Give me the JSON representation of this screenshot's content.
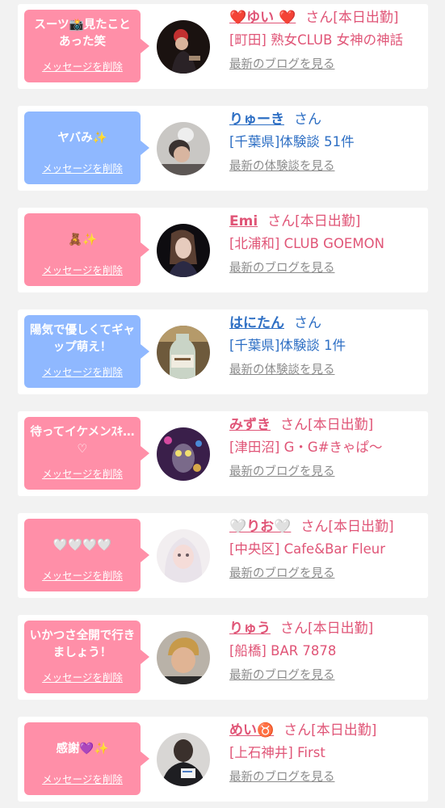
{
  "cards": [
    {
      "message": "スーツ📸見たことあった笑",
      "delete_label": "メッセージを削除",
      "name": "❤️ゆい ❤️",
      "suffix": "さん[本日出勤]",
      "shop": "[町田] 熟女CLUB 女神の神話",
      "link": "最新のブログを見る",
      "theme": "pink"
    },
    {
      "message": "ヤバみ✨",
      "delete_label": "メッセージを削除",
      "name": "りゅーき",
      "suffix": "さん",
      "shop": "[千葉県]体験談 51件",
      "link": "最新の体験談を見る",
      "theme": "blue"
    },
    {
      "message": "🧸✨",
      "delete_label": "メッセージを削除",
      "name": "Emi",
      "suffix": "さん[本日出勤]",
      "shop": "[北浦和] CLUB GOEMON",
      "link": "最新のブログを見る",
      "theme": "pink"
    },
    {
      "message": "陽気で優しくてギャップ萌え！",
      "delete_label": "メッセージを削除",
      "name": "はにたん",
      "suffix": "さん",
      "shop": "[千葉県]体験談 1件",
      "link": "最新の体験談を見る",
      "theme": "blue"
    },
    {
      "message": "待ってイケメンｽｷ…♡",
      "delete_label": "メッセージを削除",
      "name": "みずき",
      "suffix": "さん[本日出勤]",
      "shop": "[津田沼] G・G#きゃぱ〜",
      "link": "最新のブログを見る",
      "theme": "pink"
    },
    {
      "message": "🤍🤍🤍🤍",
      "delete_label": "メッセージを削除",
      "name": "🤍りお🤍",
      "suffix": "さん[本日出勤]",
      "shop": "[中央区] Cafe&Bar Fleur",
      "link": "最新のブログを見る",
      "theme": "pink"
    },
    {
      "message": "いかつさ全開で行きましょう！",
      "delete_label": "メッセージを削除",
      "name": "りゅう",
      "suffix": "さん[本日出勤]",
      "shop": "[船橋] BAR 7878",
      "link": "最新のブログを見る",
      "theme": "pink"
    },
    {
      "message": "感謝💜✨",
      "delete_label": "メッセージを削除",
      "name": "めい♉️",
      "suffix": "さん[本日出勤]",
      "shop": "[上石神井] First",
      "link": "最新のブログを見る",
      "theme": "pink"
    }
  ],
  "colors": {
    "pink_bubble": "#ff8fa8",
    "blue_bubble": "#8fb8ff",
    "pink_text": "#e05577",
    "blue_text": "#2e6fc4",
    "link_gray": "#8c8c8c",
    "background": "#f2f2f2"
  }
}
